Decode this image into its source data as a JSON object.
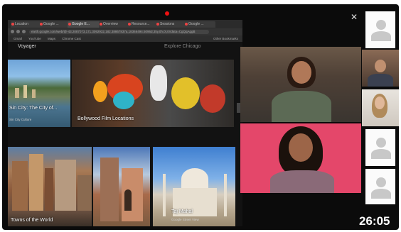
{
  "browser": {
    "tabs": [
      "Location",
      "Google ...",
      "Google E...",
      "Overview",
      "Resource...",
      "Sessions",
      "Google ..."
    ],
    "active_tab_index": 2,
    "address": "earth.google.com/web/@-43.2087073,171.3092932,182.38867837a,18366494.5096d,35y,0h,0t,0r/data=CgQqAggB",
    "bookmarks": [
      "Gmail",
      "YouTube",
      "Maps",
      "Chrome Cast"
    ],
    "other_bookmarks": "Other Bookmarks"
  },
  "earth": {
    "voyager_label": "Voyager",
    "explore_label": "Explore Chicago",
    "tiles": [
      {
        "caption": "Sin City: The City of...",
        "sub": "Sin City Culture"
      },
      {
        "caption": "Bollywood Film Locations",
        "sub": ""
      },
      {
        "caption": "Towns of the World",
        "sub": ""
      },
      {
        "caption": "",
        "sub": ""
      },
      {
        "caption": "Taj Mahal",
        "sub": "Google Street View"
      }
    ]
  },
  "call": {
    "timer": "26:05"
  },
  "colors": {
    "accent_pink": "#e4476a",
    "record_red": "#e11111"
  }
}
